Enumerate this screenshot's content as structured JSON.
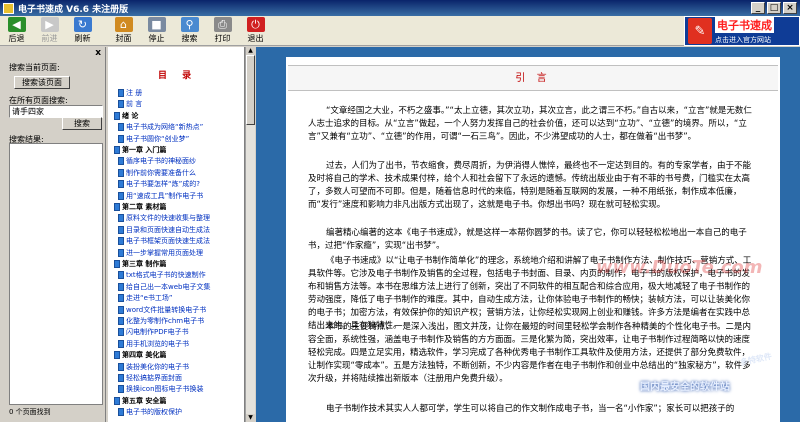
{
  "window": {
    "title": "电子书速成 V6.6 未注册版"
  },
  "toolbar": {
    "back": "后退",
    "forward": "前进",
    "refresh": "刷新",
    "cover": "封面",
    "stop": "停止",
    "search": "搜索",
    "print": "打印",
    "exit": "退出"
  },
  "banner": {
    "title": "电子书速成",
    "subtitle": "点击进入官方网站"
  },
  "left": {
    "close": "x",
    "search_current_label": "搜索当前页面:",
    "search_current_button": "搜索该页面",
    "search_all_label": "在所有页面搜索:",
    "search_all_value": "请手四家",
    "search_button": "搜索",
    "results_label": "搜索结果:",
    "status": "0 个页面找到"
  },
  "toc": {
    "title": "目 录",
    "items": [
      {
        "text": "注  册",
        "type": "i"
      },
      {
        "text": "前  言",
        "type": "i"
      },
      {
        "text": "绪  论",
        "type": "h"
      },
      {
        "text": "电子书成为网络“新热点”",
        "type": "i"
      },
      {
        "text": "电子书圆你“创业梦”",
        "type": "i"
      },
      {
        "text": "第一章 入门篇",
        "type": "h"
      },
      {
        "text": "循序电子书的神秘面纱",
        "type": "i"
      },
      {
        "text": "制作前你需要准备什么",
        "type": "i"
      },
      {
        "text": "电子书要怎样“炼”成的?",
        "type": "i"
      },
      {
        "text": "用“速成工具”制作电子书",
        "type": "i"
      },
      {
        "text": "第二章 素材篇",
        "type": "h"
      },
      {
        "text": "原料文件的快速收集与整理",
        "type": "i"
      },
      {
        "text": "目录和页面快速自动生成法",
        "type": "i"
      },
      {
        "text": "电子书框架页面快速生成法",
        "type": "i"
      },
      {
        "text": "进一步掌握常用页面处理",
        "type": "i"
      },
      {
        "text": "第三章 制作篇",
        "type": "h"
      },
      {
        "text": "txt格式电子书的快速制作",
        "type": "i"
      },
      {
        "text": "给自己出一本web电子文集",
        "type": "i"
      },
      {
        "text": "走进“e书工场”",
        "type": "i"
      },
      {
        "text": "word文件批量转换电子书",
        "type": "i"
      },
      {
        "text": "化整为零制作chm电子书",
        "type": "i"
      },
      {
        "text": "闪电制作PDF电子书",
        "type": "i"
      },
      {
        "text": "用手机浏览的电子书",
        "type": "i"
      },
      {
        "text": "第四章 美化篇",
        "type": "h"
      },
      {
        "text": "装扮美化你的电子书",
        "type": "i"
      },
      {
        "text": "轻松搞掂界面封面",
        "type": "i"
      },
      {
        "text": "换换icon图标电子书换装",
        "type": "i"
      },
      {
        "text": "第五章 安全篇",
        "type": "h"
      },
      {
        "text": "电子书的版权保护",
        "type": "i"
      }
    ]
  },
  "content": {
    "heading": "引 言",
    "paragraphs": [
      "“文章经国之大业，不朽之盛事。”“太上立德，其次立功，其次立言，此之谓三不朽。”自古以来，“立言”就是无数仁人志士追求的目标。从“立言”做起，一个人努力发挥自己的社会价值，还可以达到“立功”、“立德”的境界。所以，“立言”又兼有“立功”、“立德”的作用，可谓“一石三鸟”。因此，不少沸望成功的人士，都在做着“出书梦”。",
      "过去，人们为了出书，节衣缩食，费尽周折，为伊消得人憔悴，最终也不一定达到目的。有的专家学者，由于不能及时将自己的学术、技术成果付梓，给个人和社会留下了永远的遗憾。传统出版业由于有不菲的书号费，门槛实在太高了，多数人可望而不可即。但是，随着信息时代的来临，特别是随着互联网的发展，一种不用纸张，制作成本低廉，而“发行”速度和影响力非凡出版方式出现了，这就是电子书。你想出书吗？现在就可轻松实现。",
      "编著精心编著的这本《电子书速成》，就是这样一本帮你圆梦的书。读了它，你可以轻轻松松地出一本自己的电子书，过把“作家瘾”，实现“出书梦”。",
      "《电子书速成》以“让电子书制作简单化”的理念，系统地介绍和讲解了电子书制作方法、制作技巧、营销方式、工具软件等。它涉及电子书制作及销售的全过程，包括电子书封面、目录、内页的制作，电子书的版权保护，电子书的发布和销售方法等。本书在思维方法上进行了创新，突出了不同软件的相互配合和综合应用，极大地减轻了电子书制作的劳动强度，降低了电子书制作的难度。其中，自动生成方法，让你体验电子书制作的畅快；装帧方法，可以让装美化你的电子书；加密方法，有效保护你的知识产权；营销方法，让你经松实现网上创业和赚钱。许多方法是编者在实践中总结出来的，具有独特性。",
      "本书的主要特点，一是深入浅出，图文并茂，让你在最短的时间里轻松学会制作各种精美的个性化电子书。二是内容全面，系统性强，涵盖电子书制作及销售的方方面面。三是化繁为简，突出效率，让电子书制作过程简略以快的速度轻松完成。四是立足实用，精选软件，学习完成了各种优秀电子书制作工具软件及使用方法，还提供了部分免费软件，让制作实现“零成本”。五是方法独特，不断创新，不少内容是作者在电子书制作和创业中总结出的“独家秘方”，软件多次升级，并将陆续推出新版本（注册用户免费升级）。",
      "电子书制作技术其实人人都可学，学生可以将自己的作文制作成电子书，当一名“小作家”；家长可以把孩子的"
    ]
  },
  "watermark": {
    "site": "www.DuoTe.com",
    "corner1": "国内最安全的软件站",
    "corner2": "多特软件"
  }
}
